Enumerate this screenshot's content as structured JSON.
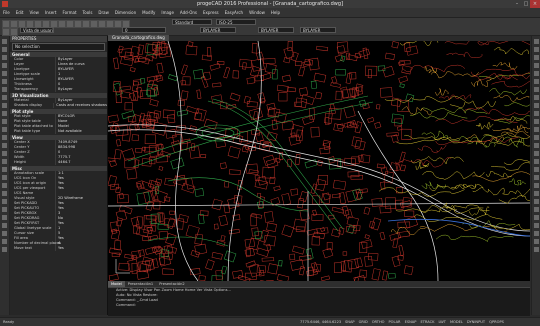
{
  "app": {
    "title": "progeCAD 2016 Professional - [Granada_cartografico.dwg]"
  },
  "menu": [
    "File",
    "Edit",
    "View",
    "Insert",
    "Format",
    "Tools",
    "Draw",
    "Dimension",
    "Modify",
    "Image",
    "Add-Ons",
    "Express",
    "EasyArch",
    "Window",
    "Help"
  ],
  "toolbar": {
    "view_name": "Vista de usuario",
    "layer": "0",
    "style": "Standard",
    "dimstyle": "ISO-25",
    "linetype": "BYLAYER",
    "lineweight": "BYLAYER",
    "color": "BYLAYER"
  },
  "properties": {
    "title": "PROPERTIES",
    "selection": "No selection",
    "sections": [
      {
        "title": "General",
        "rows": [
          {
            "k": "Color",
            "v": "ByLayer"
          },
          {
            "k": "Layer",
            "v": "Linea de curva"
          },
          {
            "k": "Linetype",
            "v": "BYLAYER"
          },
          {
            "k": "Linetype scale",
            "v": "1"
          },
          {
            "k": "Lineweight",
            "v": "BYLAYER"
          },
          {
            "k": "Thickness",
            "v": "0"
          },
          {
            "k": "Transparency",
            "v": "ByLayer"
          }
        ]
      },
      {
        "title": "3D Visualization",
        "rows": [
          {
            "k": "Material",
            "v": "ByLayer"
          },
          {
            "k": "Shadow display",
            "v": "Casts and receives shadows"
          }
        ]
      },
      {
        "title": "Plot style",
        "rows": [
          {
            "k": "Plot style",
            "v": "BYCOLOR"
          },
          {
            "k": "Plot style table",
            "v": "None"
          },
          {
            "k": "Plot table attached to",
            "v": "Model"
          },
          {
            "k": "Plot table type",
            "v": "Not available"
          }
        ]
      },
      {
        "title": "View",
        "rows": [
          {
            "k": "Center X",
            "v": "7409.8749"
          },
          {
            "k": "Center Y",
            "v": "8834.998"
          },
          {
            "k": "Center Z",
            "v": "0"
          },
          {
            "k": "Width",
            "v": "7775.7"
          },
          {
            "k": "Height",
            "v": "4464.7"
          }
        ]
      },
      {
        "title": "Misc",
        "rows": [
          {
            "k": "Annotation scale",
            "v": "1:1"
          },
          {
            "k": "UCS icon On",
            "v": "Yes"
          },
          {
            "k": "UCS icon at origin",
            "v": "Yes"
          },
          {
            "k": "UCS per viewport",
            "v": "Yes"
          },
          {
            "k": "UCS Name",
            "v": ""
          },
          {
            "k": "Visual style",
            "v": "2D Wireframe"
          },
          {
            "k": "Set PICKADD",
            "v": "Yes"
          },
          {
            "k": "Set PICKAUTO",
            "v": "Yes"
          },
          {
            "k": "Set PICKBOX",
            "v": "3"
          },
          {
            "k": "Set PICKDRAG",
            "v": "No"
          },
          {
            "k": "Set PICKFIRST",
            "v": "Yes"
          },
          {
            "k": "Global linetype scale",
            "v": "1"
          },
          {
            "k": "Cursor size",
            "v": "5"
          },
          {
            "k": "Fill area",
            "v": "Yes"
          },
          {
            "k": "Number of decimal places",
            "v": "4"
          },
          {
            "k": "Move text",
            "v": "Yes"
          }
        ]
      }
    ]
  },
  "document": {
    "tab": "Granada_cartografico.dwg"
  },
  "layout_tabs": [
    "Model",
    "Presentación1",
    "Presentación2"
  ],
  "command": {
    "lines": [
      "Active: Display    Visor   Pan   Zoom   Home   Home  Ver Vista   Options...",
      "Auto: No  Vista   Restore:",
      "Command: _.Cmd Load",
      "Command:"
    ]
  },
  "status": {
    "left": "Ready",
    "coords": "7775.6446, 4464.6223",
    "toggles": [
      "SNAP",
      "GRID",
      "ORTHO",
      "POLAR",
      "ESNAP",
      "ETRACK",
      "LWT",
      "MODEL",
      "DYNINPUT",
      "QPROPS"
    ]
  },
  "colors": {
    "background": "#000000",
    "panel": "#262626",
    "accent": "#3c3c3c"
  }
}
